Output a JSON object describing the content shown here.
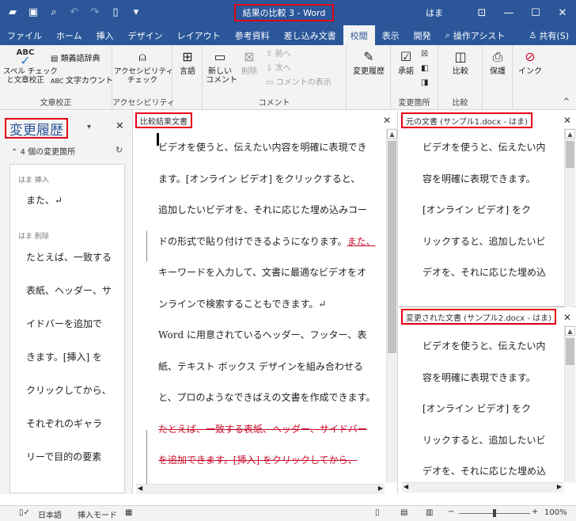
{
  "titlebar": {
    "title": "結果の比較 3  -  Word",
    "user": "はま"
  },
  "tabs": [
    "ファイル",
    "ホーム",
    "挿入",
    "デザイン",
    "レイアウト",
    "参考資料",
    "差し込み文書",
    "校閲",
    "表示",
    "開発"
  ],
  "active_tab": "校閲",
  "tell_me": "操作アシスト",
  "share": "共有(S)",
  "ribbon": {
    "proofing": {
      "spell": "スペル チェック\nと文章校正",
      "thesaurus": "類義語辞典",
      "wordcount": "文字カウント",
      "label": "文章校正"
    },
    "accessibility": {
      "check": "アクセシビリティ\nチェック",
      "label": "アクセシビリティ"
    },
    "language": {
      "btn": "言語"
    },
    "comments": {
      "new": "新しい\nコメント",
      "delete": "削除",
      "prev": "前へ",
      "next": "次へ",
      "show": "コメントの表示",
      "label": "コメント"
    },
    "tracking": {
      "btn": "変更履歴"
    },
    "changes": {
      "accept": "承諾",
      "label": "変更箇所"
    },
    "compare": {
      "btn": "比較",
      "label": "比較"
    },
    "protect": {
      "btn": "保護"
    },
    "ink": {
      "btn": "インク"
    }
  },
  "revisions_pane": {
    "title": "変更履歴",
    "count": "4 個の変更箇所",
    "items": [
      {
        "header": "はま  挿入",
        "lines": [
          "また、↵"
        ]
      },
      {
        "header": "はま  削除",
        "lines": [
          "たとえば、一致する",
          "表紙、ヘッダー、サ",
          "イドバーを追加で",
          "きます。[挿入] を",
          "クリックしてから、",
          "それぞれのギャラ",
          "リーで目的の要素"
        ]
      }
    ]
  },
  "compared_doc": {
    "title": "比較結果文書",
    "lines": [
      {
        "t": "ビデオを使うと、伝えたい内容を明確に表現でき"
      },
      {
        "t": "ます。[オンライン ビデオ] をクリックすると、"
      },
      {
        "t": "追加したいビデオを、それに応じた埋め込みコー"
      },
      {
        "t": "ドの形式で貼り付けできるようになります。",
        "ins": "また、"
      },
      {
        "t": "キーワードを入力して、文書に最適なビデオをオ"
      },
      {
        "t": "ンラインで検索することもできます。↵"
      },
      {
        "t": "Word に用意されているヘッダー、フッター、表"
      },
      {
        "t": "紙、テキスト ボックス デザインを組み合わせる"
      },
      {
        "t": "と、プロのようなできばえの文書を作成できます。"
      },
      {
        "del": "たとえば、一致する表紙、ヘッダー、サイドバー"
      },
      {
        "del": "を追加できます。[挿入] をクリックしてから、"
      }
    ]
  },
  "original_doc": {
    "title": "元の文書 (サンプル1.docx - はま)",
    "lines": [
      "ビデオを使うと、伝えたい内",
      "容を明確に表現できます。",
      "[オンライン ビデオ] をク",
      "リックすると、追加したいビ",
      "デオを、それに応じた埋め込"
    ]
  },
  "revised_doc": {
    "title": "変更された文書 (サンプル2.docx - はま)",
    "lines": [
      "ビデオを使うと、伝えたい内",
      "容を明確に表現できます。",
      "[オンライン ビデオ] をク",
      "リックすると、追加したいビ",
      "デオを、それに応じた埋め込"
    ]
  },
  "statusbar": {
    "language": "日本語",
    "mode": "挿入モード",
    "zoom": "100%"
  }
}
